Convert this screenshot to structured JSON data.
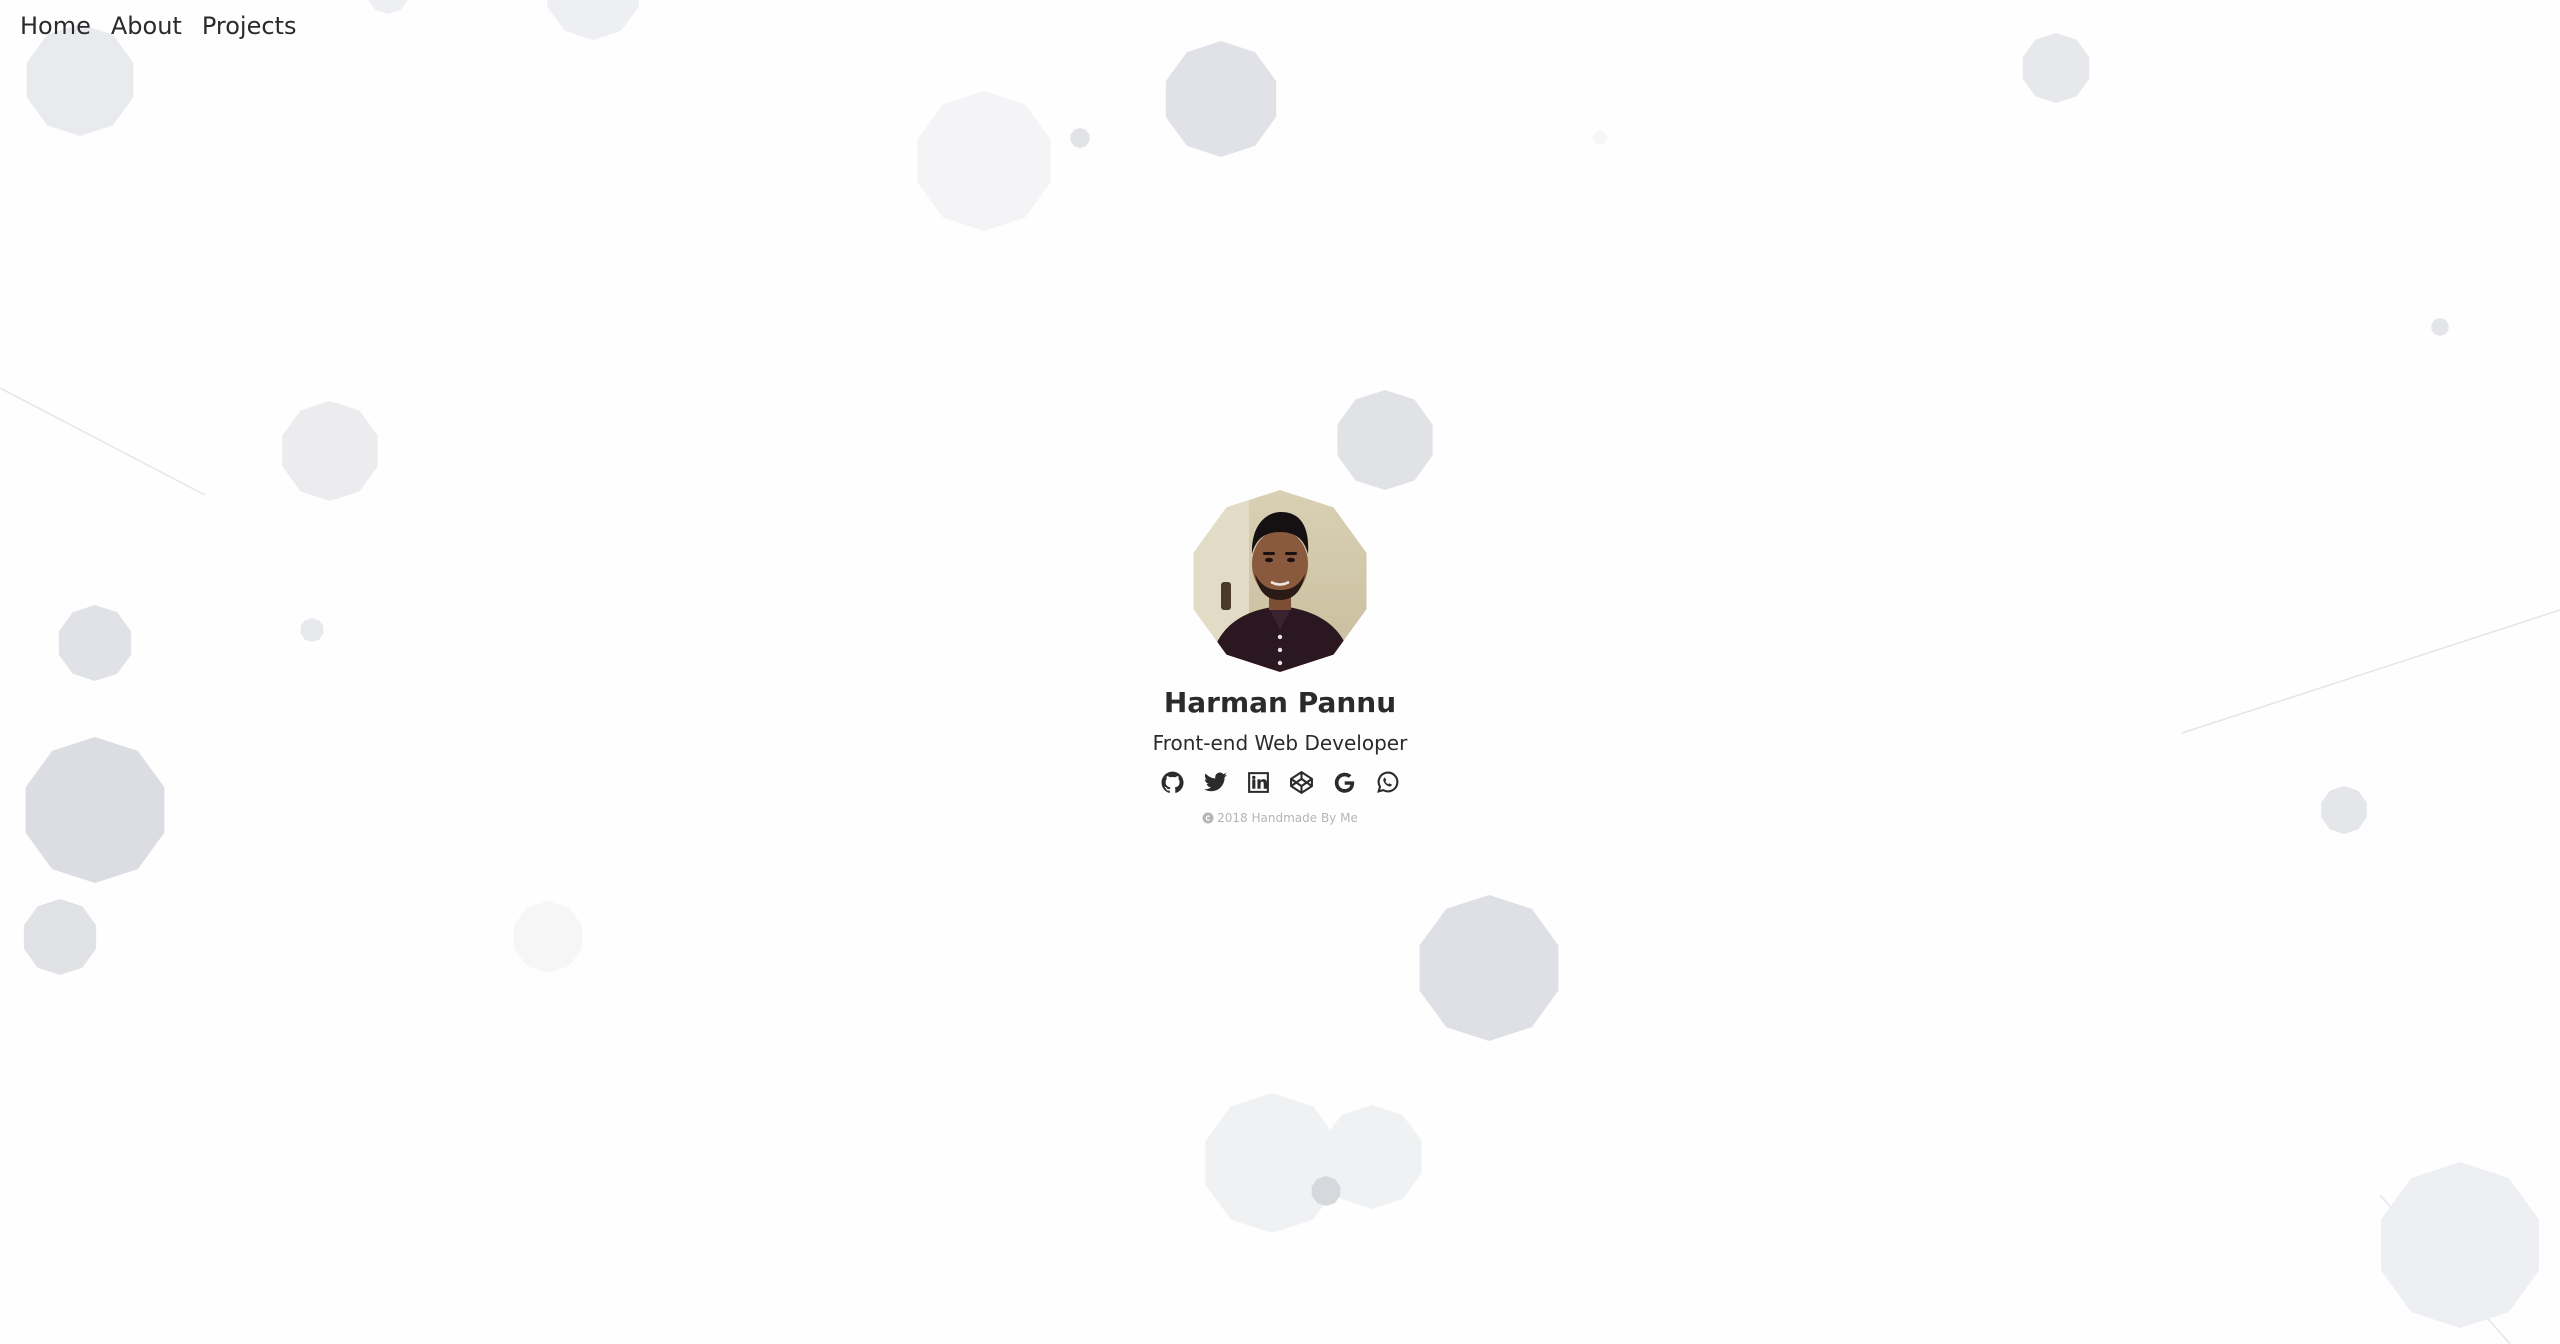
{
  "nav": {
    "items": [
      {
        "label": "Home"
      },
      {
        "label": "About"
      },
      {
        "label": "Projects"
      }
    ]
  },
  "profile": {
    "name": "Harman Pannu",
    "role": "Front-end Web Developer",
    "avatar_alt": "Harman Pannu"
  },
  "socials": [
    {
      "icon": "github-icon"
    },
    {
      "icon": "twitter-icon"
    },
    {
      "icon": "linkedin-icon"
    },
    {
      "icon": "codepen-icon"
    },
    {
      "icon": "google-icon"
    },
    {
      "icon": "whatsapp-icon"
    }
  ],
  "footer": {
    "text": "2018 Handmade By Me"
  },
  "colors": {
    "background": "#fefefe",
    "particle": "#dcdde2",
    "text": "#2b2b2b",
    "muted": "#b5b5b5"
  }
}
